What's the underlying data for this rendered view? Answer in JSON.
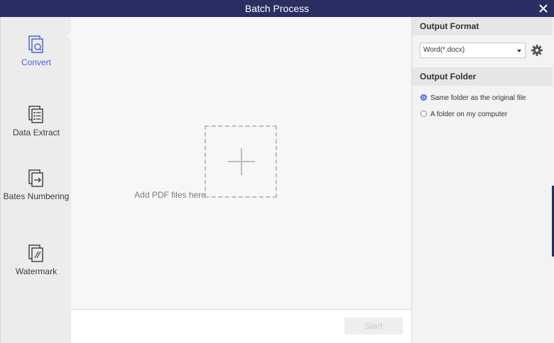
{
  "window": {
    "title": "Batch Process"
  },
  "sidebar": {
    "items": [
      {
        "label": "Convert",
        "icon": "convert-icon",
        "active": true
      },
      {
        "label": "Data Extract",
        "icon": "data-extract-icon",
        "active": false
      },
      {
        "label": "Bates Numbering",
        "icon": "bates-numbering-icon",
        "active": false
      },
      {
        "label": "Watermark",
        "icon": "watermark-icon",
        "active": false
      }
    ]
  },
  "main": {
    "drop_label": "Add PDF files here"
  },
  "footer": {
    "start_label": "Start"
  },
  "right_panel": {
    "output_format": {
      "heading": "Output Format",
      "selected": "Word(*.docx)"
    },
    "output_folder": {
      "heading": "Output Folder",
      "options": [
        {
          "label": "Same folder as the original file",
          "checked": true
        },
        {
          "label": "A folder on my computer",
          "checked": false
        }
      ]
    }
  },
  "colors": {
    "titlebar": "#2a2e62",
    "accent": "#4a63d8",
    "sidebar_bg": "#ececec",
    "main_bg": "#f7f7f7"
  }
}
